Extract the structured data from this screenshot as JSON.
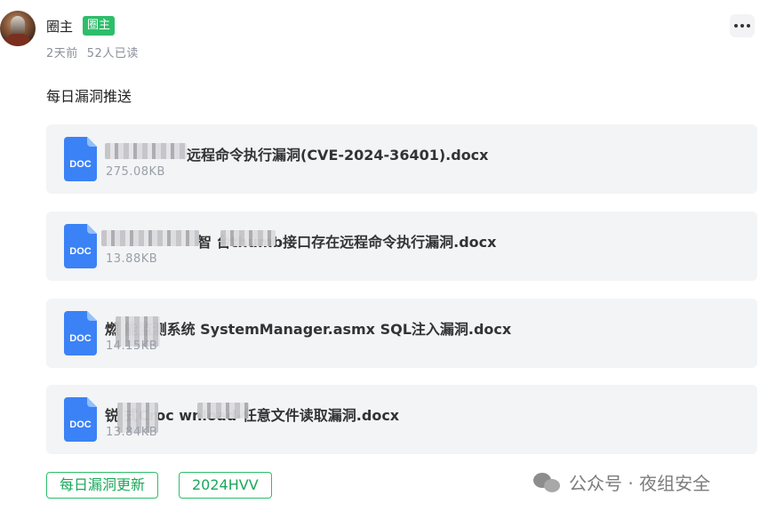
{
  "post": {
    "author_name": "圈主",
    "role_badge": "圈主",
    "time_ago": "2天前",
    "read_count": "52人已读",
    "text": "每日漏洞推送"
  },
  "attachments": [
    {
      "icon_label": "DOC",
      "name": "远程命令执行漏洞(CVE-2024-36401).docx",
      "size": "275.08KB"
    },
    {
      "icon_label": "DOC",
      "name": "智  台thumb接口存在远程命令执行漏洞.docx",
      "size": "13.88KB"
    },
    {
      "icon_label": "DOC",
      "name": "燃  能监测系统 SystemManager.asmx SQL注入漏洞.docx",
      "size": "14.15KB"
    },
    {
      "icon_label": "DOC",
      "name": "锐  式Croc  wnload-任意文件读取漏洞.docx",
      "size": "13.84KB"
    }
  ],
  "tags": [
    "每日漏洞更新",
    "2024HVV"
  ],
  "watermark": {
    "text": "公众号 · 夜组安全",
    "icon": "wechat-icon"
  },
  "icons": {
    "more": "more-options-icon",
    "file": "docx-file-icon"
  },
  "colors": {
    "accent_green": "#2ebd6b",
    "doc_blue": "#3b82f6",
    "card_bg": "#f3f4f6"
  }
}
